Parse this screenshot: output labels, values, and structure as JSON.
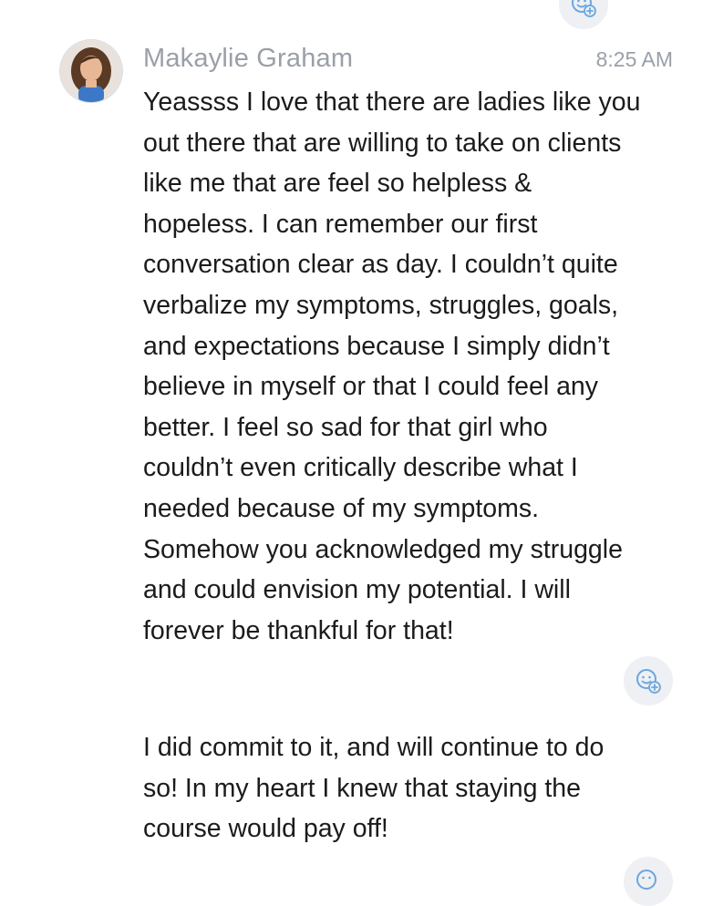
{
  "message_group": {
    "sender_name": "Makaylie Graham",
    "timestamp": "8:25 AM",
    "avatar": "profile-photo",
    "messages": [
      {
        "text": "Yeassss I love that there are ladies like you\nout there that are willing to take on clients\nlike me that are feel so helpless &\nhopeless. I can remember our first\nconversation clear as day. I couldn’t quite\nverbalize my symptoms, struggles, goals,\nand expectations because I simply didn’t\nbelieve in myself or that I could feel any\nbetter. I feel so sad for that girl who\ncouldn’t even critically describe what I\nneeded because of my symptoms.\nSomehow you acknowledged my struggle\nand could envision my potential. I will\nforever be thankful for that!"
      },
      {
        "text": "I did commit to it, and will continue to do\nso! In my heart I knew that staying the\ncourse would pay off!"
      }
    ]
  },
  "icons": {
    "reaction": "add-reaction-icon"
  },
  "colors": {
    "background": "#ffffff",
    "meta_text": "#9aa0a8",
    "body_text": "#1b1b1b",
    "reaction_bg": "#eef0f3",
    "reaction_icon": "#6aa6e0"
  }
}
